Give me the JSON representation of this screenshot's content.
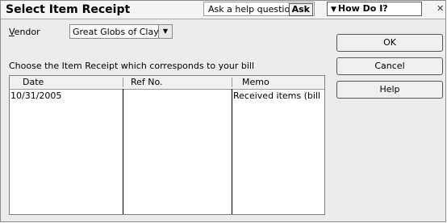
{
  "window": {
    "title": "Select Item Receipt",
    "help_prompt": "Ask a help question",
    "ask_label": "Ask",
    "how_do_i_label": "How Do I?",
    "close_glyph": "✕"
  },
  "vendor": {
    "label": "Vendor",
    "label_underline_char": "V",
    "label_rest": "endor",
    "value": "Great Globs of Clay",
    "caret_glyph": "▼"
  },
  "instruction": "Choose the Item Receipt which corresponds to your bill",
  "table": {
    "columns": [
      "Date",
      "Ref No.",
      "Memo"
    ],
    "rows": [
      {
        "date": "10/31/2005",
        "ref": "",
        "memo": "Received items (bill ..."
      }
    ]
  },
  "buttons": {
    "ok": "OK",
    "cancel": "Cancel",
    "help": "Help"
  }
}
